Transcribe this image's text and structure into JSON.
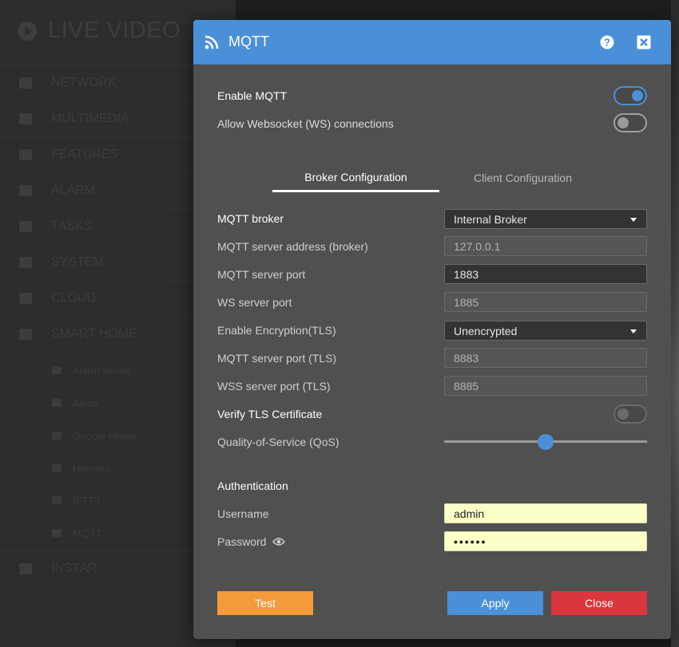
{
  "background": {
    "app_title": "LIVE VIDEO",
    "menu": [
      "NETWORK",
      "MULTIMEDIA",
      "FEATURES",
      "ALARM",
      "TASKS",
      "SYSTEM",
      "CLOUD",
      "SMART HOME"
    ],
    "submenu": [
      "Alarm server",
      "Alexa",
      "Google Home",
      "Homekit",
      "IFTTT",
      "MQTT"
    ],
    "last_item": "INSTAR"
  },
  "modal": {
    "title": "MQTT",
    "toggles": {
      "enable_mqtt": {
        "label": "Enable MQTT",
        "on": true
      },
      "allow_ws": {
        "label": "Allow Websocket (WS) connections",
        "on": false
      }
    },
    "tabs": [
      "Broker Configuration",
      "Client Configuration"
    ],
    "fields": {
      "broker": {
        "label": "MQTT broker",
        "value": "Internal Broker"
      },
      "server_address": {
        "label": "MQTT server address (broker)",
        "value": "127.0.0.1"
      },
      "server_port": {
        "label": "MQTT server port",
        "value": "1883"
      },
      "ws_port": {
        "label": "WS server port",
        "value": "1885"
      },
      "encryption": {
        "label": "Enable Encryption(TLS)",
        "value": "Unencrypted"
      },
      "tls_port": {
        "label": "MQTT server port (TLS)",
        "value": "8883"
      },
      "wss_port": {
        "label": "WSS server port (TLS)",
        "value": "8885"
      },
      "verify_tls": {
        "label": "Verify TLS Certificate",
        "on": false
      },
      "qos": {
        "label": "Quality-of-Service (QoS)",
        "value_fraction": 0.5
      }
    },
    "auth": {
      "heading": "Authentication",
      "username_label": "Username",
      "username": "admin",
      "password_label": "Password",
      "password_mask": "••••••"
    },
    "buttons": {
      "test": "Test",
      "apply": "Apply",
      "close": "Close"
    }
  }
}
